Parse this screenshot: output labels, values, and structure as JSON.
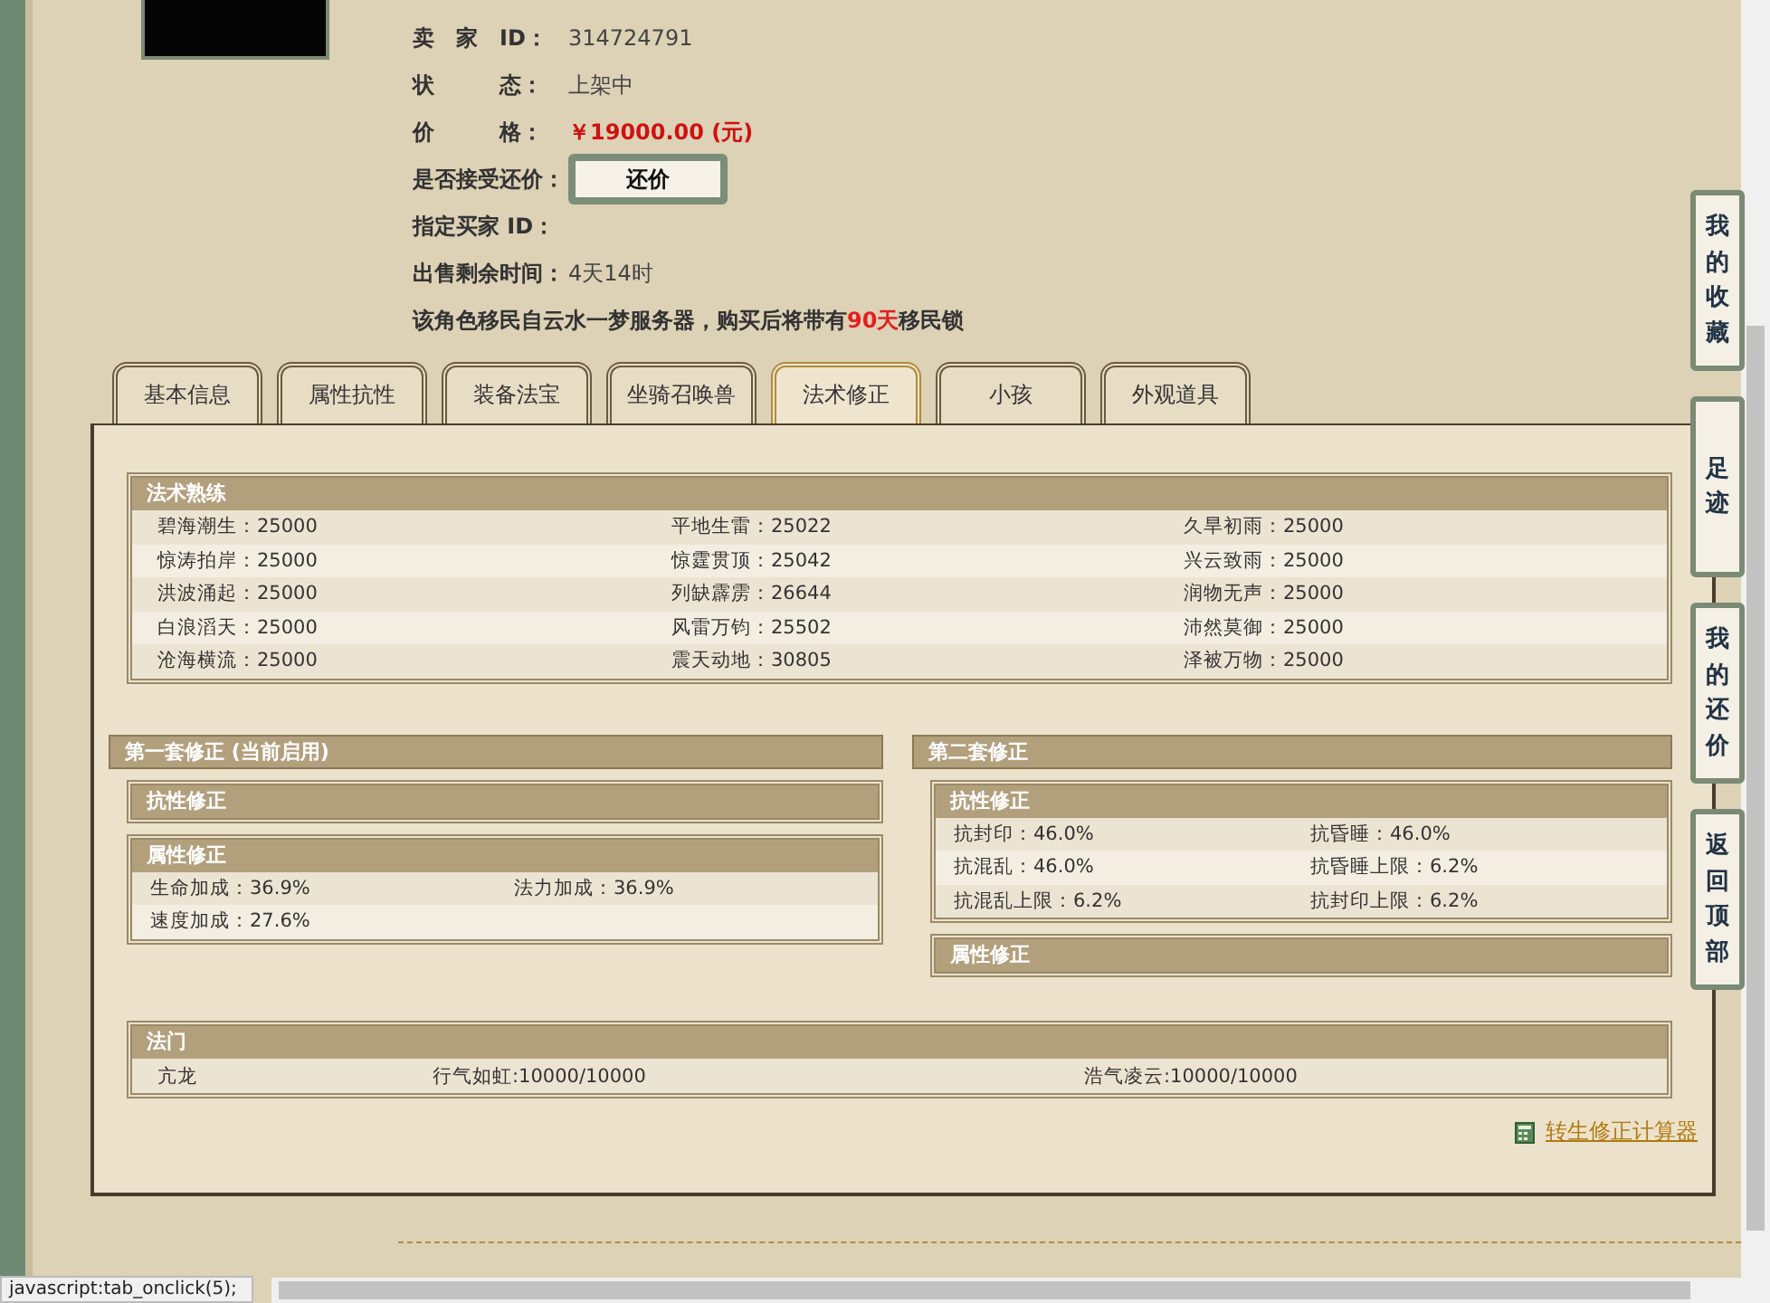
{
  "seller_info": [
    {
      "label": "卖　家　ID：",
      "value": "314724791",
      "kind": "text"
    },
    {
      "label": "状　　　态：",
      "value": "上架中",
      "kind": "text"
    },
    {
      "label": "价　　　格：",
      "value": "￥19000.00 (元)",
      "kind": "price"
    },
    {
      "label": "是否接受还价：",
      "value": "还价",
      "kind": "button"
    },
    {
      "label": "指定买家 ID：",
      "kind": "text"
    },
    {
      "label": "出售剩余时间：",
      "value": "4天14时",
      "kind": "text"
    }
  ],
  "notice": "该角色移民自云水一梦服务器，购买后将带有**90天**移民锁",
  "tabs": [
    {
      "label": "基本信息",
      "selected": false
    },
    {
      "label": "属性抗性",
      "selected": false
    },
    {
      "label": "装备法宝",
      "selected": false
    },
    {
      "label": "坐骑召唤兽",
      "selected": false
    },
    {
      "label": "法术修正",
      "selected": true
    },
    {
      "label": "小孩",
      "selected": false
    },
    {
      "label": "外观道具",
      "selected": false
    }
  ],
  "spell_mastery": {
    "title": "法术熟练",
    "rows": [
      [
        "碧海潮生：25000",
        "平地生雷：25022",
        "久旱初雨：25000"
      ],
      [
        "惊涛拍岸：25000",
        "惊霆贯顶：25042",
        "兴云致雨：25000"
      ],
      [
        "洪波涌起：25000",
        "列缺霹雳：26644",
        "润物无声：25000"
      ],
      [
        "白浪滔天：25000",
        "风雷万钧：25502",
        "沛然莫御：25000"
      ],
      [
        "沧海横流：25000",
        "震天动地：30805",
        "泽被万物：25000"
      ]
    ]
  },
  "correction_sets": [
    {
      "title": "第一套修正 (当前启用)",
      "sections": [
        {
          "title": "抗性修正"
        },
        {
          "title": "属性修正",
          "rows": [
            [
              "生命加成：36.9%",
              "法力加成：36.9%"
            ],
            [
              "速度加成：27.6%"
            ]
          ]
        }
      ]
    },
    {
      "title": "第二套修正",
      "sections": [
        {
          "title": "抗性修正",
          "rows": [
            [
              "抗封印：46.0%",
              "抗昏睡：46.0%"
            ],
            [
              "抗混乱：46.0%",
              "抗昏睡上限：6.2%"
            ],
            [
              "抗混乱上限：6.2%",
              "抗封印上限：6.2%"
            ]
          ]
        },
        {
          "title": "属性修正"
        }
      ]
    }
  ],
  "school": {
    "title": "法门",
    "row": [
      "亢龙",
      "行气如虹:10000/10000",
      "浩气凌云:10000/10000"
    ]
  },
  "calculator_link": "转生修正计算器",
  "side_nav": [
    "我的收藏",
    "足迹",
    "我的还价",
    "返回顶部"
  ],
  "status_bar": "javascript:tab_onclick(5);"
}
